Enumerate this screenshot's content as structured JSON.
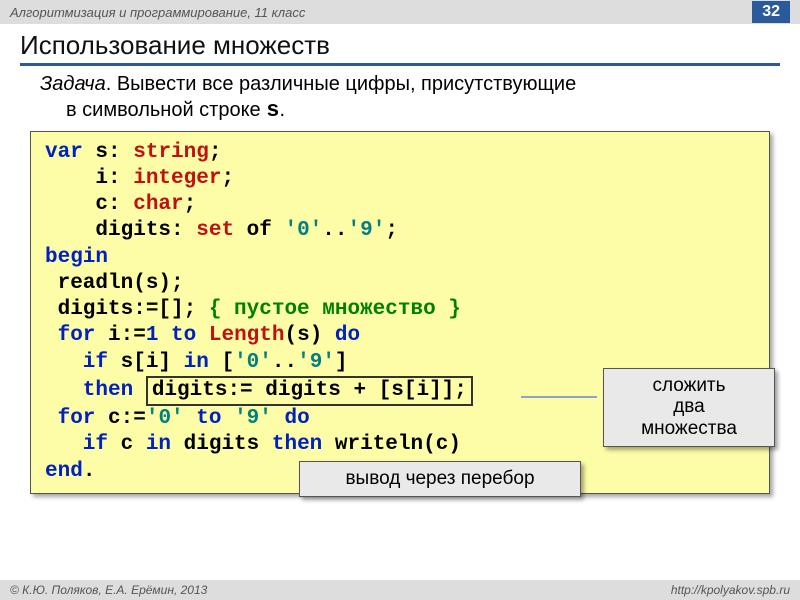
{
  "header": {
    "course": "Алгоритмизация и программирование, 11 класс",
    "page": "32"
  },
  "title": "Использование множеств",
  "problem": {
    "label": "Задача",
    "text_line1": ". Вывести все различные цифры, присутствующие",
    "text_line2": "в символьной строке ",
    "var": "s",
    "period": "."
  },
  "code": {
    "l1a": "var",
    "l1b": " s: ",
    "l1c": "string",
    "l1d": ";",
    "l2a": "    i: ",
    "l2b": "integer",
    "l2c": ";",
    "l3a": "    c: ",
    "l3b": "char",
    "l3c": ";",
    "l4a": "    digits: ",
    "l4b": "set",
    "l4c": " of ",
    "l4d": "'0'",
    "l4e": "..",
    "l4f": "'9'",
    "l4g": ";",
    "l5a": "begin",
    "l6a": " readln(s);",
    "l7a": " digits:=[]; ",
    "l7b": "{ пустое множество }",
    "l8a": " for",
    "l8b": " i:=",
    "l8c": "1",
    "l8d": " to ",
    "l8e": "Length",
    "l8f": "(s) ",
    "l8g": "do",
    "l9a": "   if",
    "l9b": " s[i] ",
    "l9c": "in",
    "l9d": " [",
    "l9e": "'0'",
    "l9f": "..",
    "l9g": "'9'",
    "l9h": "]",
    "l10a": "   then ",
    "l10b": "digits:= digits + [s[i]];",
    "l11a": " for",
    "l11b": " c:=",
    "l11c": "'0'",
    "l11d": " to ",
    "l11e": "'9'",
    "l11f": " do",
    "l12a": "   if",
    "l12b": " c ",
    "l12c": "in",
    "l12d": " digits ",
    "l12e": "then",
    "l12f": " writeln(c)",
    "l13a": "end",
    "l13b": "."
  },
  "callouts": {
    "c1_l1": "сложить",
    "c1_l2": "два",
    "c1_l3": "множества",
    "c2": "вывод через перебор"
  },
  "footer": {
    "left": "© К.Ю. Поляков, Е.А. Ерёмин, 2013",
    "right": "http://kpolyakov.spb.ru"
  }
}
